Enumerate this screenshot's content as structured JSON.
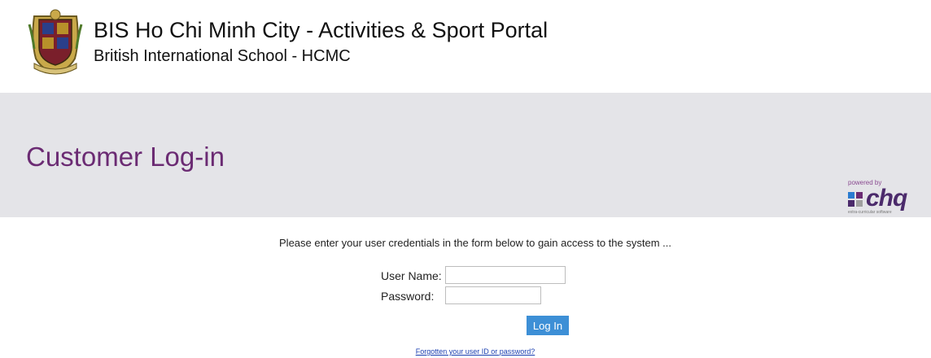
{
  "header": {
    "site_title": "BIS Ho Chi Minh City - Activities & Sport Portal",
    "site_subtitle": "British International School - HCMC",
    "crest_icon": "school-crest-icon"
  },
  "banner": {
    "page_title": "Customer Log-in",
    "powered_by": "powered by",
    "brand": "chq",
    "brand_tagline": "extra-curricular software",
    "colors": {
      "title": "#6b2b73",
      "banner_bg": "#e4e4e8"
    }
  },
  "form": {
    "intro": "Please enter your user credentials in the form below to gain access to the system ...",
    "username_label": "User Name:",
    "username_value": "",
    "password_label": "Password:",
    "password_value": "",
    "login_label": "Log In",
    "forgot_link": "Forgotten your user ID or password?",
    "colors": {
      "button": "#3d8fd6",
      "link": "#1a3fb0"
    }
  }
}
